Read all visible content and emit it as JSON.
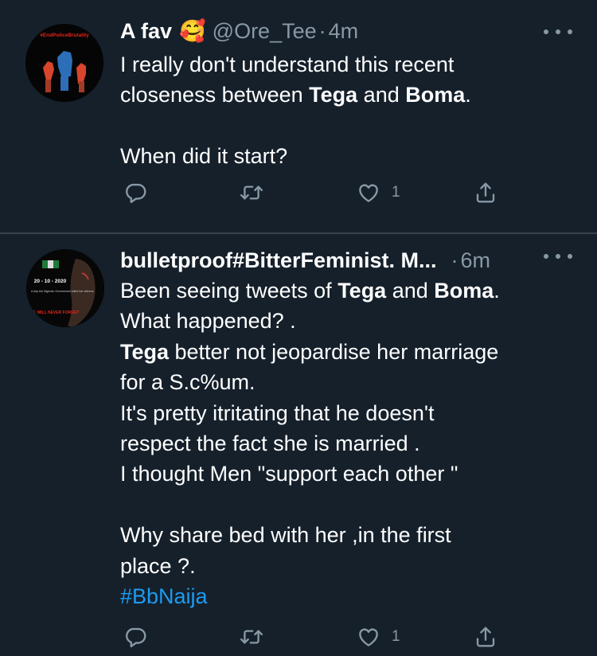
{
  "tweets": [
    {
      "name": "A fav",
      "emoji": "🥰",
      "handle": "@Ore_Tee",
      "separator": "·",
      "time": "4m",
      "avatar_text": "#EndPoliceBrutality",
      "text_segments": [
        {
          "text": "I really don't understand this recent\ncloseness between ",
          "bold": false
        },
        {
          "text": "Tega",
          "bold": true
        },
        {
          "text": " and ",
          "bold": false
        },
        {
          "text": "Boma",
          "bold": true
        },
        {
          "text": ".\n\nWhen did it start?",
          "bold": false
        }
      ],
      "like_count": "1",
      "icons": {
        "reply": "reply-icon",
        "retweet": "retweet-icon",
        "like": "heart-icon",
        "share": "share-icon",
        "more": "more-dots-icon"
      }
    },
    {
      "name": "bulletproof#BitterFeminist. M...",
      "separator": "·",
      "time": "6m",
      "avatar_text": [
        "20 - 10 - 2020",
        "A day the Nigerian Government killed her citizens",
        "WE WILL NEVER FORGET"
      ],
      "text_segments": [
        {
          "text": "Been seeing tweets of ",
          "bold": false
        },
        {
          "text": "Tega",
          "bold": true
        },
        {
          "text": " and ",
          "bold": false
        },
        {
          "text": "Boma",
          "bold": true
        },
        {
          "text": ".\nWhat happened? .\n",
          "bold": false
        },
        {
          "text": "Tega",
          "bold": true
        },
        {
          "text": " better not jeopardise her marriage\nfor a S.c%um.\nIt's pretty itritating that he doesn't\nrespect the fact she is married .\nI thought Men \"support each other \"\n\nWhy share bed with her ,in the first\nplace ?.\n",
          "bold": false
        },
        {
          "text": "#BbNaija",
          "bold": false,
          "hashtag": true
        }
      ],
      "like_count": "1",
      "icons": {
        "reply": "reply-icon",
        "retweet": "retweet-icon",
        "like": "heart-icon",
        "share": "share-icon",
        "more": "more-dots-icon"
      }
    }
  ],
  "colors": {
    "background": "#15202b",
    "divider": "#38444d",
    "text": "#ffffff",
    "muted": "#8899a6",
    "link": "#1d9bf0"
  }
}
